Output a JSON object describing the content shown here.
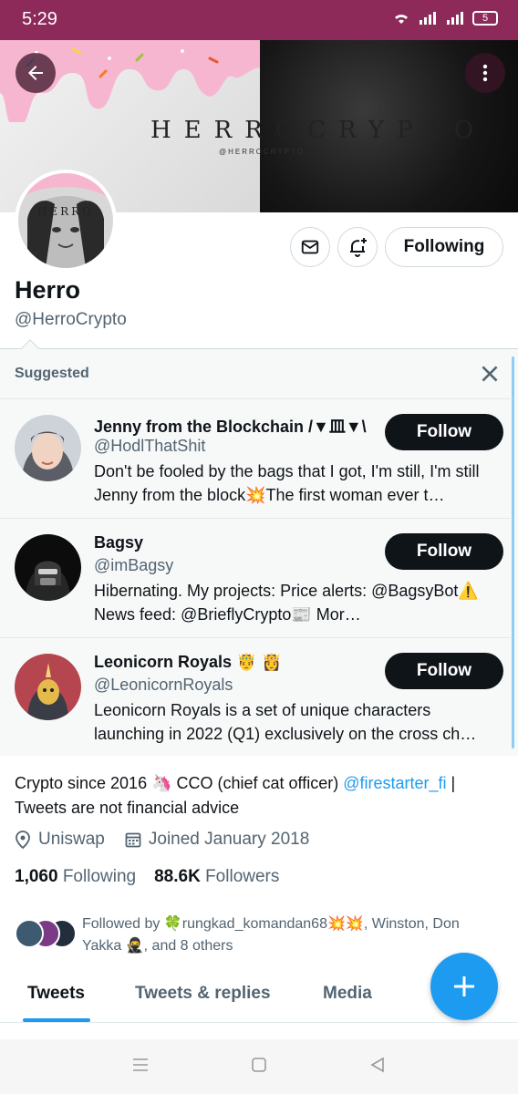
{
  "status_bar": {
    "time": "5:29",
    "battery": "5"
  },
  "profile": {
    "banner_text": "HERROCRYPTO",
    "banner_subtext": "@HERROCRYPTO",
    "name": "Herro",
    "handle": "@HerroCrypto",
    "following_button": "Following",
    "bio_text": "Crypto since 2016 🦄 CCO (chief cat officer) ",
    "bio_link": "@firestarter_fi",
    "bio_after": " | Tweets are not financial advice",
    "location": "Uniswap",
    "joined": "Joined January 2018",
    "following_count": "1,060",
    "following_label": "Following",
    "followers_count": "88.6K",
    "followers_label": "Followers",
    "followed_by": "Followed by 🍀rungkad_komandan68💥💥, Winston, Don Yakka 🥷, and 8 others"
  },
  "suggested": {
    "title": "Suggested",
    "items": [
      {
        "name": "Jenny from the Blockchain /▼皿▼\\",
        "handle": "@HodlThatShit",
        "bio": "Don't be fooled by the bags that I got, I'm still, I'm still Jenny from the block💥The first woman ever t…",
        "button": "Follow"
      },
      {
        "name": "Bagsy",
        "handle": "@imBagsy",
        "bio": "Hibernating.  My projects: Price alerts: @BagsyBot⚠️ News feed: @BrieflyCrypto📰 Mor…",
        "button": "Follow"
      },
      {
        "name": "Leonicorn Royals 🤴 👸",
        "handle": "@LeonicornRoyals",
        "bio": "Leonicorn Royals is a set of unique characters launching in 2022 (Q1) exclusively on the cross ch…",
        "button": "Follow"
      }
    ]
  },
  "tabs": [
    "Tweets",
    "Tweets & replies",
    "Media"
  ],
  "colors": {
    "accent": "#1d9bf0",
    "status_bar": "#8d2a5a",
    "text_primary": "#0f1419",
    "text_secondary": "#536471"
  }
}
